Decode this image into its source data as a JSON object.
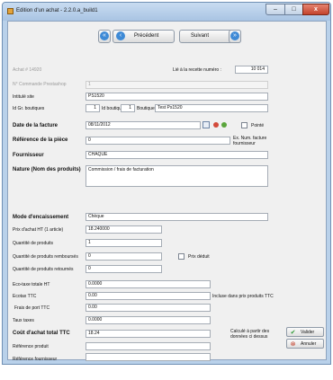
{
  "window": {
    "title": "Edition d'un achat - 2.2.0.a_build1",
    "controls": {
      "minimize": "–",
      "maximize": "□",
      "close": "x"
    }
  },
  "nav": {
    "first_glyph": "«",
    "prev_glyph": "‹",
    "prev_label": "Précédent",
    "next_label": "Suivant",
    "next_glyph": "›",
    "last_glyph": "»"
  },
  "header": {
    "achat_label": "Achat # 14920",
    "recette_label": "Lié à la recette numéro :",
    "recette_value": "10 014",
    "commande_label": "N° Commande Prestashop",
    "commande_value": "1",
    "site_label": "Intitulé site",
    "site_value": "PS1520",
    "gr_label": "Id Gr. boutiques",
    "gr_value": "1",
    "idboutique_label": "Id boutique",
    "idboutique_value": "1",
    "boutique_label": "Boutique",
    "boutique_value": "Test Ps1520"
  },
  "invoice": {
    "date_label": "Date de la facture",
    "date_value": "08/11/2012",
    "pointe_label": "Pointé",
    "piece_label": "Référence de la pièce",
    "piece_value": "0",
    "ex_label": "Ex. Num. facture fournisseur",
    "fournisseur_label": "Fournisseur",
    "fournisseur_value": "CHAQUE",
    "nature_label": "Nature (Nom des produits)",
    "nature_value": "Commission / frais de facturation"
  },
  "details": {
    "mode_label": "Mode d'encaissement",
    "mode_value": "Chèque",
    "prix_label": "Prix d'achat HT (1 article)",
    "prix_value": "18.240000",
    "qte_label": "Quantité de produits",
    "qte_value": "1",
    "remb_label": "Quantité de produits remboursés",
    "remb_value": "0",
    "prix_deduit_label": "Prix déduit",
    "retour_label": "Quantité de produits retournés",
    "retour_value": "0",
    "ecotaxe_ht_label": "Eco-taxe totale HT",
    "ecotaxe_ht_value": "0.0000",
    "ecotax_ttc_label": "Ecotax TTC",
    "ecotax_ttc_value": "0.00",
    "ecotax_note": "Incluse dans prix produits TTC",
    "port_label": "Frais de port TTC",
    "port_value": "0.00",
    "taux_label": "Taux taxes",
    "taux_value": "0.0000",
    "cout_label": "Coût d'achat total TTC",
    "cout_value": "18.24",
    "cout_note_1": "Calculé à partir des",
    "cout_note_2": "données ci dessus",
    "ref_produit_label": "Référence produit",
    "ref_produit_value": "",
    "ref_fournisseur_label": "Référence fournisseur",
    "ref_fournisseur_value": ""
  },
  "actions": {
    "valider_glyph": "✔",
    "valider_label": "Valider",
    "annuler_glyph": "⊗",
    "annuler_label": "Annuler"
  },
  "colors": {
    "accent": "#3e8ad6",
    "valider": "#2e9a35",
    "annuler": "#c2361f"
  }
}
